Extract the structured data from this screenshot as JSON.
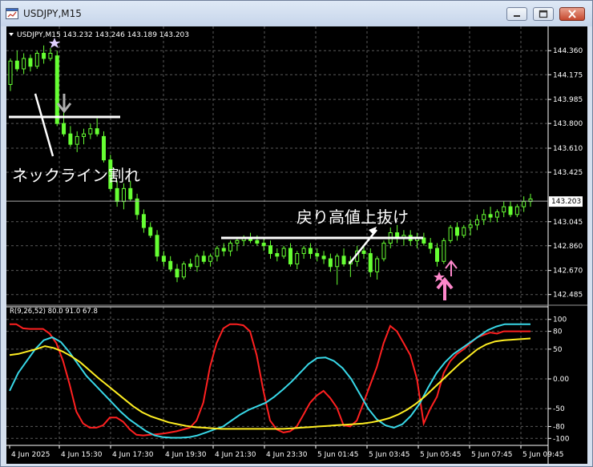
{
  "window": {
    "title": "USDJPY,M15"
  },
  "main": {
    "header": "USDJPY,M15  143.232 143.246 143.189 143.203",
    "price_axis": [
      "144.360",
      "144.175",
      "143.985",
      "143.800",
      "143.610",
      "143.425",
      "143.045",
      "142.860",
      "142.670",
      "142.485"
    ],
    "current_price": "143.203",
    "annotations": {
      "neckline": "ネックライン割れ",
      "pullback": "戻り高値上抜け"
    }
  },
  "indicator": {
    "header": "R(9,26,52) 80.0 91.0 67.8",
    "levels": [
      "100",
      "80",
      "50",
      "0.00",
      "-50",
      "-80",
      "-100"
    ]
  },
  "time_axis": [
    "4 Jun 2025",
    "4 Jun 15:30",
    "4 Jun 17:30",
    "4 Jun 19:30",
    "4 Jun 21:30",
    "4 Jun 23:30",
    "5 Jun 01:45",
    "5 Jun 03:45",
    "5 Jun 05:45",
    "5 Jun 07:45",
    "5 Jun 09:45"
  ],
  "colors": {
    "background": "#000000",
    "bull_candle": "#000000",
    "bear_candle": "#66ff33",
    "wick": "#66ff33",
    "grid": "#5a5a5a",
    "axis_text": "#ffffff",
    "rsi_short": "#ff2020",
    "rsi_mid": "#38d8e8",
    "rsi_long": "#ffee22",
    "sell_arrow": "#b0b0b0",
    "buy_arrow": "#ff88cc"
  },
  "chart_data": [
    {
      "type": "candlestick",
      "title": "USDJPY,M15",
      "ylim": [
        142.44,
        144.46
      ],
      "candles": [
        [
          144.1,
          144.3,
          144.05,
          144.28
        ],
        [
          144.28,
          144.36,
          144.2,
          144.22
        ],
        [
          144.22,
          144.34,
          144.18,
          144.3
        ],
        [
          144.3,
          144.33,
          144.2,
          144.24
        ],
        [
          144.24,
          144.36,
          144.22,
          144.34
        ],
        [
          144.34,
          144.4,
          144.26,
          144.3
        ],
        [
          144.3,
          144.38,
          144.28,
          144.34
        ],
        [
          144.32,
          144.36,
          143.78,
          143.8
        ],
        [
          143.8,
          143.92,
          143.7,
          143.72
        ],
        [
          143.72,
          143.78,
          143.62,
          143.64
        ],
        [
          143.64,
          143.74,
          143.58,
          143.7
        ],
        [
          143.7,
          143.76,
          143.64,
          143.72
        ],
        [
          143.72,
          143.8,
          143.68,
          143.76
        ],
        [
          143.76,
          143.84,
          143.7,
          143.72
        ],
        [
          143.7,
          143.74,
          143.5,
          143.52
        ],
        [
          143.52,
          143.56,
          143.28,
          143.3
        ],
        [
          143.3,
          143.36,
          143.16,
          143.2
        ],
        [
          143.2,
          143.34,
          143.14,
          143.3
        ],
        [
          143.3,
          143.36,
          143.2,
          143.22
        ],
        [
          143.22,
          143.26,
          143.06,
          143.1
        ],
        [
          143.1,
          143.14,
          142.96,
          143.0
        ],
        [
          143.0,
          143.04,
          142.92,
          142.94
        ],
        [
          142.94,
          142.98,
          142.74,
          142.78
        ],
        [
          142.78,
          142.82,
          142.7,
          142.74
        ],
        [
          142.74,
          142.78,
          142.66,
          142.68
        ],
        [
          142.68,
          142.72,
          142.58,
          142.62
        ],
        [
          142.62,
          142.74,
          142.6,
          142.72
        ],
        [
          142.72,
          142.76,
          142.68,
          142.7
        ],
        [
          142.7,
          142.8,
          142.66,
          142.78
        ],
        [
          142.78,
          142.82,
          142.72,
          142.74
        ],
        [
          142.74,
          142.8,
          142.7,
          142.78
        ],
        [
          142.78,
          142.86,
          142.74,
          142.84
        ],
        [
          142.84,
          142.88,
          142.78,
          142.82
        ],
        [
          142.82,
          142.9,
          142.78,
          142.88
        ],
        [
          142.88,
          142.92,
          142.82,
          142.9
        ],
        [
          142.9,
          142.94,
          142.86,
          142.92
        ],
        [
          142.92,
          142.96,
          142.88,
          142.9
        ],
        [
          142.9,
          142.94,
          142.86,
          142.88
        ],
        [
          142.88,
          142.92,
          142.82,
          142.86
        ],
        [
          142.86,
          142.9,
          142.76,
          142.8
        ],
        [
          142.8,
          142.84,
          142.74,
          142.78
        ],
        [
          142.78,
          142.86,
          142.76,
          142.84
        ],
        [
          142.84,
          142.88,
          142.7,
          142.72
        ],
        [
          142.72,
          142.82,
          142.68,
          142.8
        ],
        [
          142.8,
          142.86,
          142.76,
          142.84
        ],
        [
          142.84,
          142.88,
          142.76,
          142.8
        ],
        [
          142.8,
          142.84,
          142.74,
          142.78
        ],
        [
          142.78,
          142.82,
          142.72,
          142.76
        ],
        [
          142.76,
          142.8,
          142.66,
          142.7
        ],
        [
          142.7,
          142.8,
          142.56,
          142.78
        ],
        [
          142.78,
          142.84,
          142.7,
          142.72
        ],
        [
          142.72,
          142.78,
          142.62,
          142.74
        ],
        [
          142.74,
          142.86,
          142.7,
          142.82
        ],
        [
          142.82,
          142.86,
          142.76,
          142.8
        ],
        [
          142.8,
          142.84,
          142.62,
          142.66
        ],
        [
          142.66,
          142.78,
          142.6,
          142.76
        ],
        [
          142.76,
          142.9,
          142.74,
          142.88
        ],
        [
          142.88,
          143.0,
          142.84,
          142.96
        ],
        [
          142.96,
          143.02,
          142.88,
          142.92
        ],
        [
          142.92,
          142.98,
          142.86,
          142.94
        ],
        [
          142.94,
          142.98,
          142.86,
          142.9
        ],
        [
          142.9,
          142.96,
          142.84,
          142.92
        ],
        [
          142.92,
          142.96,
          142.86,
          142.88
        ],
        [
          142.88,
          142.92,
          142.8,
          142.84
        ],
        [
          142.84,
          142.88,
          142.7,
          142.74
        ],
        [
          142.74,
          142.92,
          142.72,
          142.9
        ],
        [
          142.9,
          143.02,
          142.88,
          143.0
        ],
        [
          143.0,
          143.04,
          142.9,
          142.94
        ],
        [
          142.94,
          143.02,
          142.92,
          143.0
        ],
        [
          143.0,
          143.06,
          142.94,
          143.02
        ],
        [
          143.02,
          143.1,
          142.98,
          143.06
        ],
        [
          143.06,
          143.14,
          143.02,
          143.1
        ],
        [
          143.1,
          143.16,
          143.04,
          143.08
        ],
        [
          143.08,
          143.14,
          143.04,
          143.12
        ],
        [
          143.12,
          143.2,
          143.08,
          143.16
        ],
        [
          143.16,
          143.2,
          143.08,
          143.1
        ],
        [
          143.1,
          143.18,
          143.08,
          143.16
        ],
        [
          143.16,
          143.24,
          143.12,
          143.2
        ],
        [
          143.2,
          143.26,
          143.16,
          143.22
        ]
      ],
      "current_price": 143.203
    },
    {
      "type": "line",
      "title": "R(9,26,52) 80.0 91.0 67.8",
      "ylim": [
        -105,
        105
      ],
      "series": [
        {
          "name": "",
          "values": [
            92,
            92,
            85,
            84,
            84,
            84,
            76,
            60,
            30,
            -10,
            -55,
            -75,
            -82,
            -82,
            -78,
            -65,
            -65,
            -72,
            -85,
            -94,
            -95,
            -94,
            -93,
            -92,
            -90,
            -88,
            -85,
            -82,
            -70,
            -40,
            20,
            60,
            85,
            92,
            92,
            90,
            80,
            40,
            -20,
            -70,
            -85,
            -90,
            -88,
            -80,
            -60,
            -40,
            -28,
            -20,
            -32,
            -48,
            -78,
            -80,
            -70,
            -40,
            -10,
            20,
            60,
            89,
            80,
            60,
            40,
            0,
            -75,
            -50,
            -30,
            10,
            30,
            42,
            50,
            60,
            70,
            74,
            78,
            76,
            80,
            80,
            80,
            80,
            80
          ]
        },
        {
          "name": "",
          "values": [
            -20,
            10,
            30,
            50,
            65,
            70,
            62,
            45,
            25,
            5,
            -10,
            -25,
            -40,
            -55,
            -68,
            -78,
            -88,
            -95,
            -98,
            -99,
            -99,
            -98,
            -95,
            -90,
            -85,
            -80,
            -70,
            -60,
            -52,
            -46,
            -40,
            -30,
            -18,
            -5,
            10,
            25,
            35,
            36,
            30,
            18,
            0,
            -25,
            -50,
            -68,
            -78,
            -82,
            -76,
            -62,
            -42,
            -15,
            10,
            28,
            42,
            52,
            62,
            72,
            82,
            88,
            92,
            92,
            92,
            92
          ]
        },
        {
          "name": "",
          "values": [
            40,
            42,
            46,
            50,
            55,
            52,
            46,
            38,
            28,
            15,
            2,
            -10,
            -22,
            -34,
            -46,
            -56,
            -63,
            -68,
            -73,
            -76,
            -79,
            -81,
            -82,
            -83,
            -84,
            -84,
            -84,
            -84,
            -84,
            -84,
            -84,
            -84,
            -83,
            -82,
            -81,
            -80,
            -79,
            -78,
            -77,
            -76,
            -75,
            -73,
            -70,
            -66,
            -60,
            -52,
            -42,
            -30,
            -16,
            -2,
            12,
            26,
            38,
            50,
            58,
            63,
            65,
            66,
            67,
            68
          ]
        }
      ]
    }
  ]
}
